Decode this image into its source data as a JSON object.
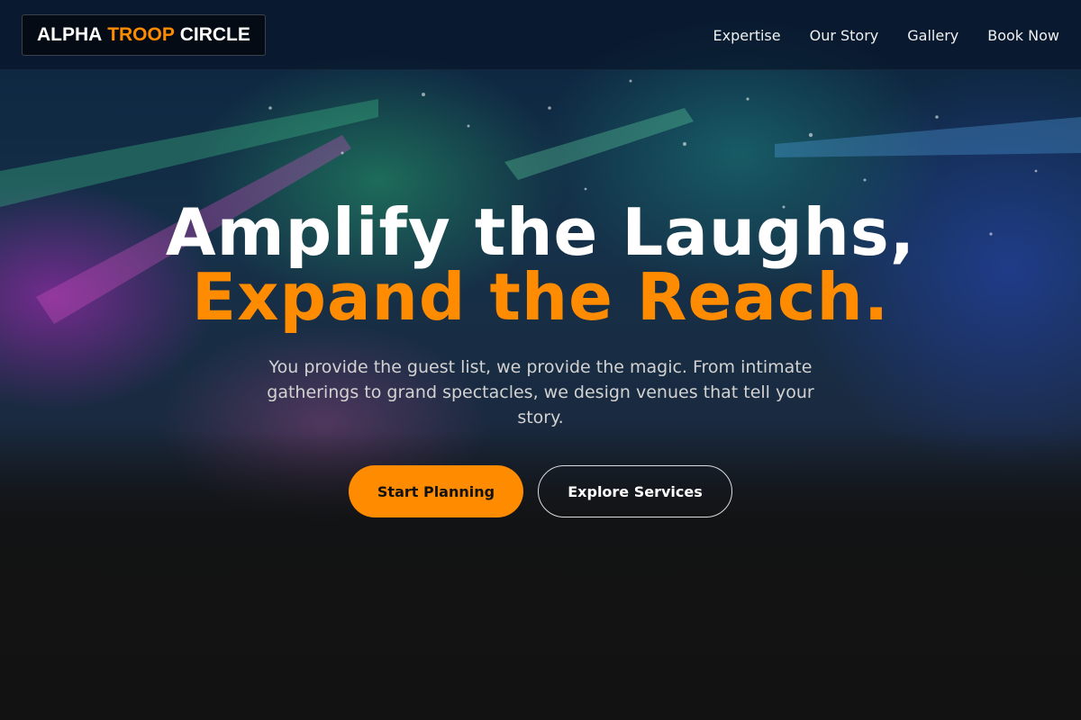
{
  "brand": {
    "name_part1": "ALPHA",
    "name_part2": "TROOP",
    "name_part3": "CIRCLE",
    "accent_color": "#ff8c00"
  },
  "nav": {
    "items": [
      {
        "label": "Expertise"
      },
      {
        "label": "Our Story"
      },
      {
        "label": "Gallery"
      },
      {
        "label": "Book Now"
      }
    ]
  },
  "hero": {
    "headline_line1": "Amplify the Laughs,",
    "headline_line2": "Expand the Reach.",
    "subtext": "You provide the guest list, we provide the magic. From intimate gatherings to grand spectacles, we design venues that tell your story.",
    "primary_cta": "Start Planning",
    "secondary_cta": "Explore Services",
    "background_color": "#121212"
  }
}
